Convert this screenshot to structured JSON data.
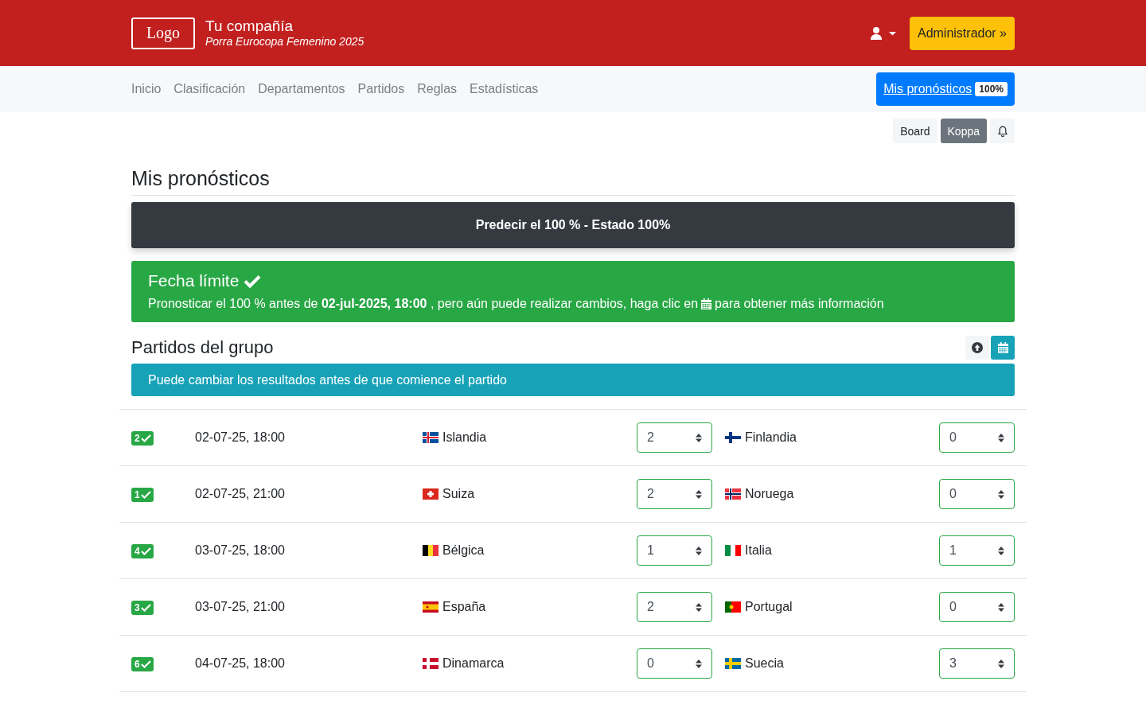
{
  "header": {
    "logo": "Logo",
    "company": "Tu compañía",
    "subtitle": "Porra Eurocopa Femenino 2025",
    "admin_button": "Administrador »"
  },
  "nav": {
    "items": [
      "Inicio",
      "Clasificación",
      "Departamentos",
      "Partidos",
      "Reglas",
      "Estadísticas"
    ],
    "predictions_button": {
      "label": "Mis pronósticos",
      "badge": "100%"
    }
  },
  "toolbar": {
    "buttons": [
      {
        "label": "Board",
        "selected": false
      },
      {
        "label": "Koppa",
        "selected": true
      }
    ]
  },
  "page_title": "Mis pronósticos",
  "status_bar": "Predecir el 100 % - Estado 100%",
  "deadline": {
    "title": "Fecha límite",
    "text_before": "Pronosticar el 100 % antes de **02-jul-2025, 18:00** , pero aún puede realizar cambios, haga clic en",
    "text_after": "para obtener más información"
  },
  "group": {
    "title": "Partidos del grupo",
    "info": "Puede cambiar los resultados antes de que comience el partido"
  },
  "matches": [
    {
      "badge": "2",
      "date": "02-07-25, 18:00",
      "home": {
        "name": "Islandia",
        "kind": "nordicblue"
      },
      "home_score": "2",
      "away": {
        "name": "Finlandia",
        "kind": "nordicwhite"
      },
      "away_score": "0"
    },
    {
      "badge": "1",
      "date": "02-07-25, 21:00",
      "home": {
        "name": "Suiza",
        "kind": "swiss"
      },
      "home_score": "2",
      "away": {
        "name": "Noruega",
        "kind": "nordicred"
      },
      "away_score": "0"
    },
    {
      "badge": "4",
      "date": "03-07-25, 18:00",
      "home": {
        "name": "Bélgica",
        "kind": "tricolorbe"
      },
      "home_score": "1",
      "away": {
        "name": "Italia",
        "kind": "tricolorit"
      },
      "away_score": "1"
    },
    {
      "badge": "3",
      "date": "03-07-25, 21:00",
      "home": {
        "name": "España",
        "kind": "bandses"
      },
      "home_score": "2",
      "away": {
        "name": "Portugal",
        "kind": "bicolorpt"
      },
      "away_score": "0"
    },
    {
      "badge": "6",
      "date": "04-07-25, 18:00",
      "home": {
        "name": "Dinamarca",
        "kind": "nordicdk"
      },
      "home_score": "0",
      "away": {
        "name": "Suecia",
        "kind": "nordicse"
      },
      "away_score": "3"
    }
  ]
}
